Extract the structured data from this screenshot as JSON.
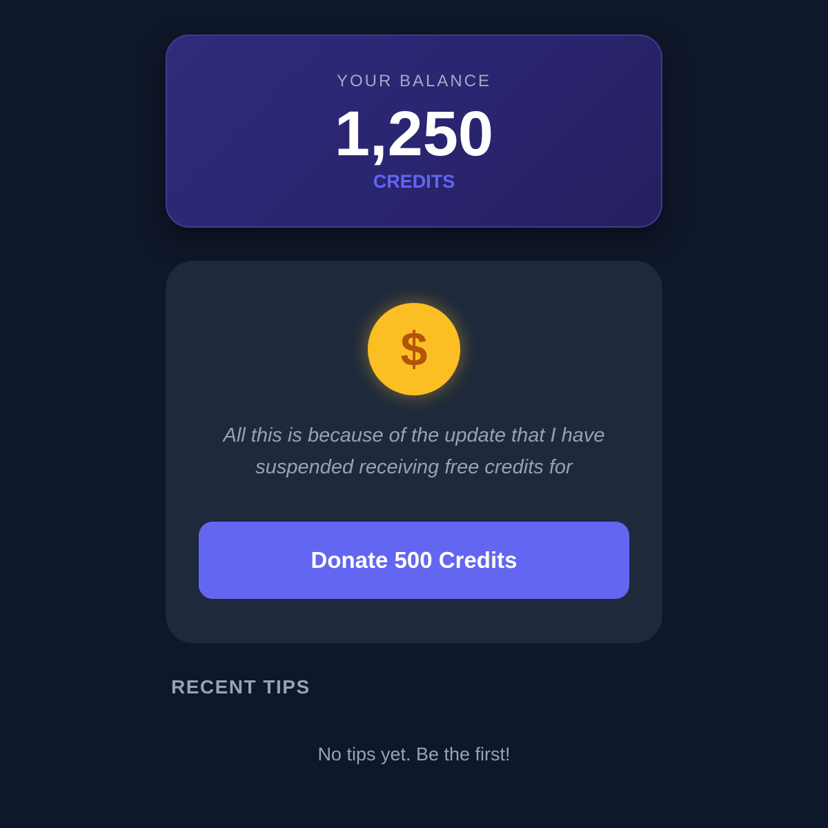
{
  "balance": {
    "label": "YOUR BALANCE",
    "value": "1,250",
    "unit": "CREDITS"
  },
  "donate": {
    "icon": "dollar-coin-icon",
    "icon_glyph": "$",
    "message": "All this is because of the update that I have suspended receiving free credits for",
    "button_label": "Donate 500 Credits"
  },
  "recent_tips": {
    "heading": "RECENT TIPS",
    "empty_text": "No tips yet. Be the first!"
  },
  "colors": {
    "background": "#0f172a",
    "card": "#1e293b",
    "accent": "#6366f1",
    "coin": "#fbbf24",
    "coin_glyph": "#b45309"
  }
}
